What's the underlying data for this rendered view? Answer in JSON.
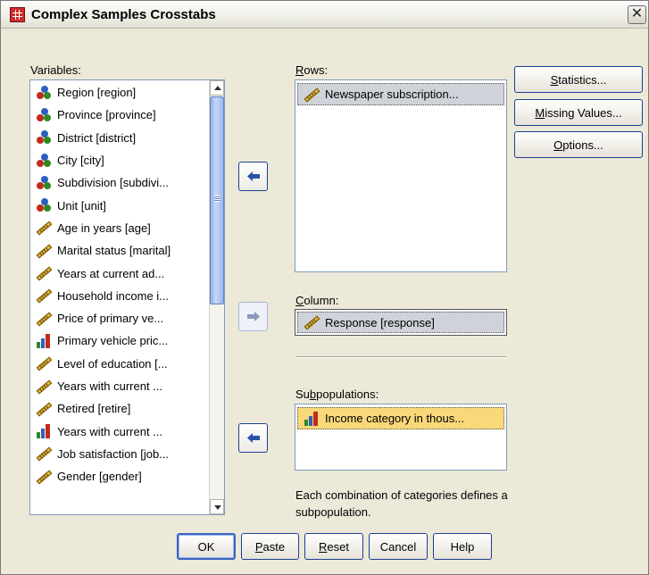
{
  "window": {
    "title": "Complex Samples Crosstabs"
  },
  "variables_label": "Variables:",
  "variables": [
    {
      "label": "Region [region]",
      "icon": "nominal-icon"
    },
    {
      "label": "Province [province]",
      "icon": "nominal-icon"
    },
    {
      "label": "District [district]",
      "icon": "nominal-icon"
    },
    {
      "label": "City [city]",
      "icon": "nominal-icon"
    },
    {
      "label": "Subdivision [subdivi...",
      "icon": "nominal-icon"
    },
    {
      "label": "Unit [unit]",
      "icon": "nominal-icon"
    },
    {
      "label": "Age in years [age]",
      "icon": "scale-icon"
    },
    {
      "label": "Marital status [marital]",
      "icon": "scale-icon"
    },
    {
      "label": "Years at current ad...",
      "icon": "scale-icon"
    },
    {
      "label": "Household income i...",
      "icon": "scale-icon"
    },
    {
      "label": "Price of primary ve...",
      "icon": "scale-icon"
    },
    {
      "label": "Primary vehicle pric...",
      "icon": "ordinal-icon"
    },
    {
      "label": "Level of education [...",
      "icon": "scale-icon"
    },
    {
      "label": "Years with current ...",
      "icon": "scale-icon"
    },
    {
      "label": "Retired [retire]",
      "icon": "scale-icon"
    },
    {
      "label": "Years with current ...",
      "icon": "ordinal-icon"
    },
    {
      "label": "Job satisfaction [job...",
      "icon": "scale-icon"
    },
    {
      "label": "Gender [gender]",
      "icon": "scale-icon"
    }
  ],
  "rows_label": "Rows:",
  "rows_items": [
    {
      "label": "Newspaper subscription...",
      "icon": "scale-icon"
    }
  ],
  "column_label": "Column:",
  "column_value": "Response [response]",
  "subpop_label": "Subpopulations:",
  "subpop_items": [
    {
      "label": "Income category in thous...",
      "icon": "ordinal-icon"
    }
  ],
  "subpop_note": "Each combination of categories defines a subpopulation.",
  "side_buttons": {
    "statistics": "Statistics...",
    "missing": "Missing Values...",
    "options": "Options..."
  },
  "bottom_buttons": {
    "ok": "OK",
    "paste": "Paste",
    "reset": "Reset",
    "cancel": "Cancel",
    "help": "Help"
  },
  "colors": {
    "selection_gray": "#cfd2d8",
    "selection_yellow": "#f8d878",
    "accent": "#1c3f94"
  }
}
